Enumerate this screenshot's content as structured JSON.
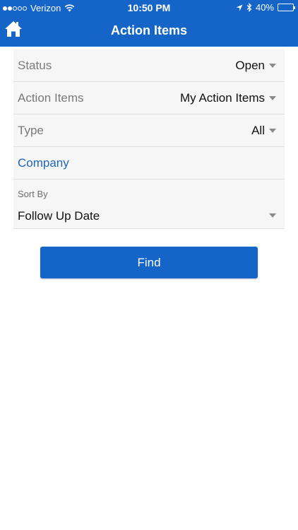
{
  "status_bar": {
    "carrier": "Verizon",
    "time": "10:50 PM",
    "battery": "40%",
    "battery_level": 0.4
  },
  "header": {
    "title": "Action Items",
    "home_icon": "home-icon"
  },
  "filters": {
    "status": {
      "label": "Status",
      "value": "Open"
    },
    "action_items": {
      "label": "Action Items",
      "value": "My Action Items"
    },
    "type": {
      "label": "Type",
      "value": "All"
    },
    "company": {
      "label": "Company"
    },
    "sort_by": {
      "label": "Sort By",
      "value": "Follow Up Date"
    }
  },
  "find_label": "Find",
  "colors": {
    "brand": "#1565c8",
    "link": "#1e66b8",
    "panel": "#f6f6f6"
  }
}
